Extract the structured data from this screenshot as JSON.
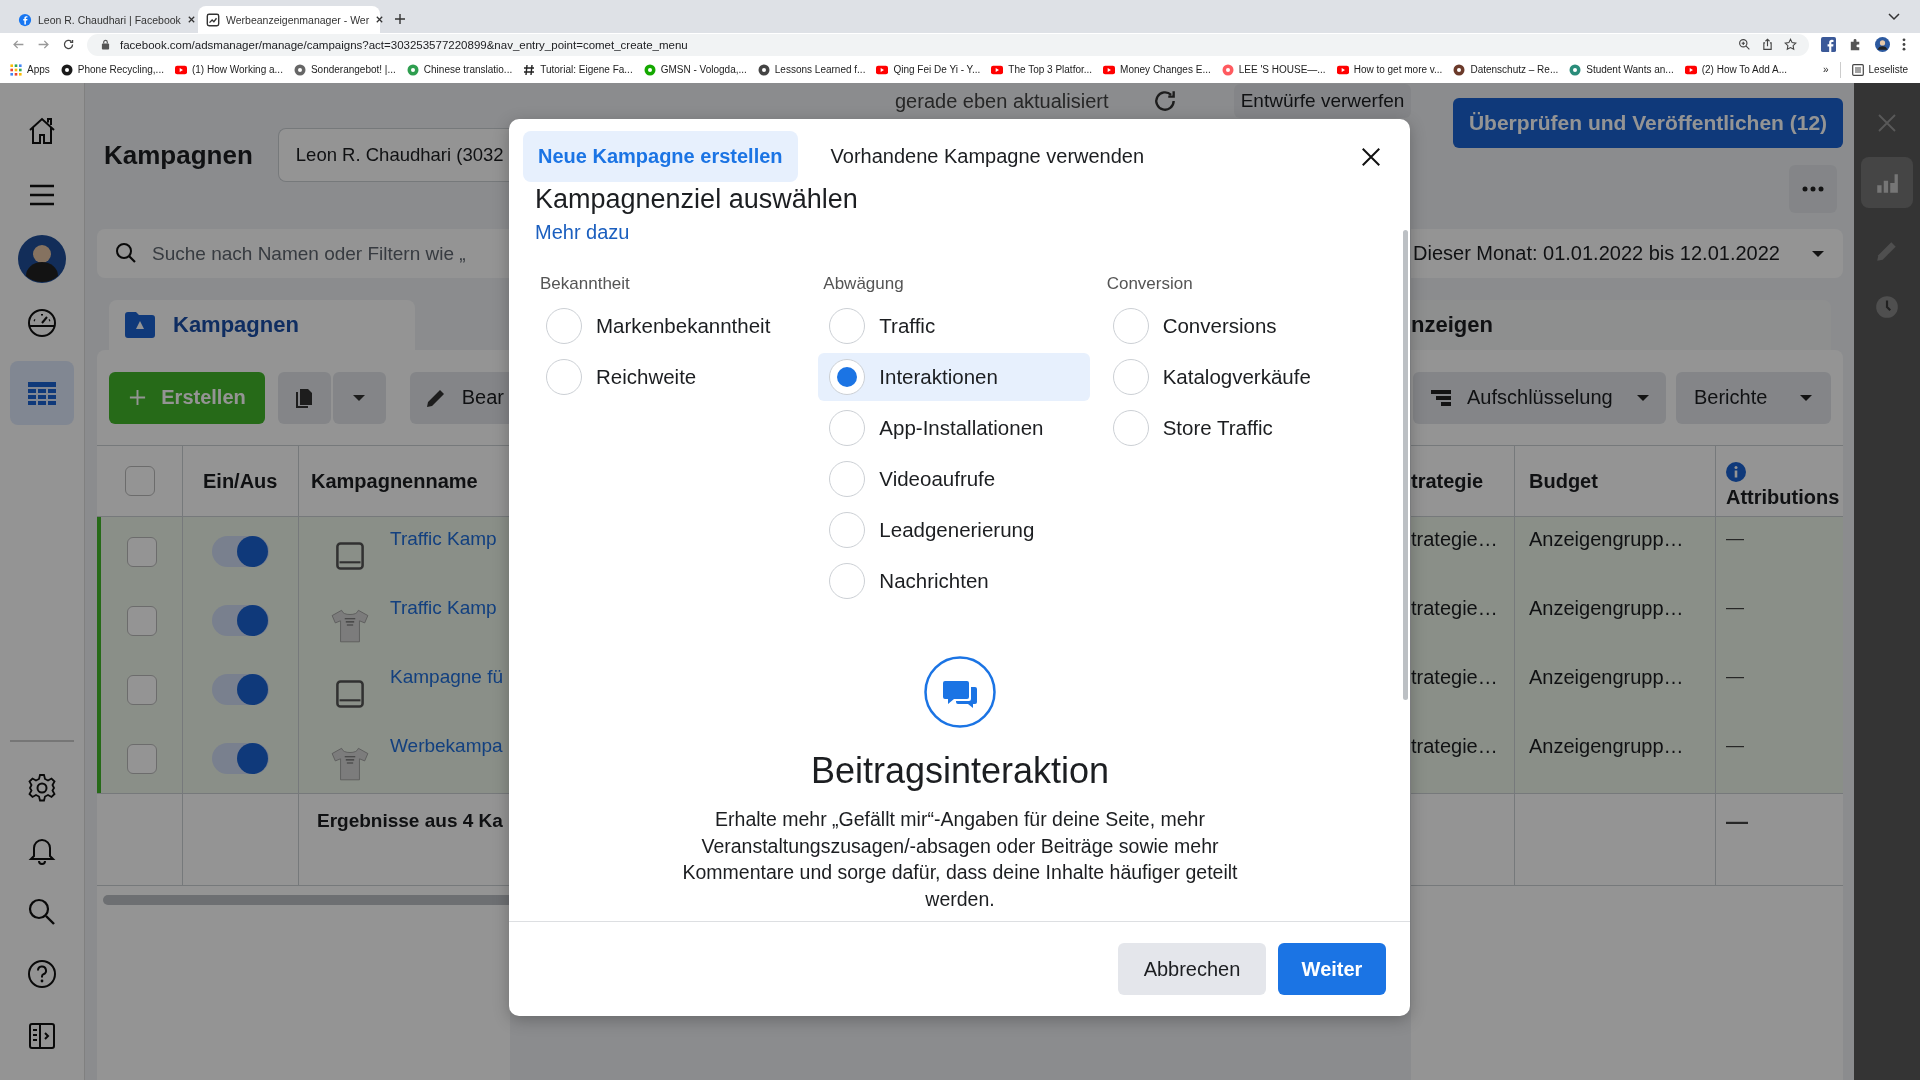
{
  "browser": {
    "tabs": [
      {
        "title": "Leon R. Chaudhari | Facebook",
        "selected": false,
        "kind": "facebook"
      },
      {
        "title": "Werbeanzeigenmanager - Wer",
        "selected": true,
        "kind": "ads"
      }
    ],
    "url": "facebook.com/adsmanager/manage/campaigns?act=303253577220899&nav_entry_point=comet_create_menu",
    "bookmarks": [
      {
        "label": "Apps",
        "kind": "apps"
      },
      {
        "label": "Phone Recycling,...",
        "kind": "o2"
      },
      {
        "label": "(1) How Working a...",
        "kind": "youtube"
      },
      {
        "label": "Sonderangebot! |...",
        "kind": "verified"
      },
      {
        "label": "Chinese translatio...",
        "kind": "leaf"
      },
      {
        "label": "Tutorial: Eigene Fa...",
        "kind": "hash"
      },
      {
        "label": "GMSN - Vologda,...",
        "kind": "up"
      },
      {
        "label": "Lessons Learned f...",
        "kind": "lessons"
      },
      {
        "label": "Qing Fei De Yi - Y...",
        "kind": "youtube"
      },
      {
        "label": "The Top 3 Platfor...",
        "kind": "youtube"
      },
      {
        "label": "Money Changes E...",
        "kind": "youtube"
      },
      {
        "label": "LEE 'S HOUSE—...",
        "kind": "airbnb"
      },
      {
        "label": "How to get more v...",
        "kind": "youtube"
      },
      {
        "label": "Datenschutz – Re...",
        "kind": "photo"
      },
      {
        "label": "Student Wants an...",
        "kind": "letter"
      },
      {
        "label": "(2) How To Add A...",
        "kind": "youtube"
      }
    ],
    "more": "»",
    "reading_list": "Leseliste"
  },
  "nav": {
    "top": [
      {
        "kind": "home",
        "selected": false
      },
      {
        "kind": "menu",
        "selected": false
      },
      {
        "kind": "profile",
        "selected": false
      },
      {
        "kind": "gauge",
        "selected": false
      },
      {
        "kind": "table",
        "selected": true
      }
    ],
    "bottom": [
      {
        "kind": "gear",
        "selected": false
      },
      {
        "kind": "bell",
        "selected": false
      },
      {
        "kind": "search",
        "selected": false
      },
      {
        "kind": "help",
        "selected": false
      },
      {
        "kind": "panel",
        "selected": false
      }
    ]
  },
  "header": {
    "title": "Kampagnen",
    "account": "Leon R. Chaudhari (3032",
    "status": "gerade eben aktualisiert",
    "discard": "Entwürfe verwerfen",
    "publish": "Überprüfen und Veröffentlichen (12)"
  },
  "search": {
    "placeholder": "Suche nach Namen oder Filtern wie „"
  },
  "date_range": "Dieser Monat: 01.01.2022 bis 12.01.2022",
  "level_tabs": [
    {
      "label": "Kampagnen",
      "selected": true
    },
    {
      "label": "nzeigen",
      "selected": false
    }
  ],
  "toolbar": {
    "create": "Erstellen",
    "edit": "Bear",
    "breakdown": "Aufschlüsselung",
    "reports": "Berichte"
  },
  "table": {
    "select_all_checked": false,
    "columns_left": [
      "Ein/Aus",
      "Kampagnenname"
    ],
    "columns_right": [
      "trategie",
      "Budget",
      "Attributions"
    ],
    "rows": [
      {
        "checked": false,
        "on": true,
        "kind": "device",
        "name": "Traffic Kamp",
        "strategy": "trategie…",
        "budget": "Anzeigengrupp…",
        "attribution": "—"
      },
      {
        "checked": false,
        "on": true,
        "kind": "shirt",
        "name": "Traffic Kamp",
        "strategy": "trategie…",
        "budget": "Anzeigengrupp…",
        "attribution": "—"
      },
      {
        "checked": false,
        "on": true,
        "kind": "device",
        "name": "Kampagne fü",
        "strategy": "trategie…",
        "budget": "Anzeigengrupp…",
        "attribution": "—"
      },
      {
        "checked": false,
        "on": true,
        "kind": "shirt",
        "name": "Werbekampa",
        "strategy": "trategie…",
        "budget": "Anzeigengrupp…",
        "attribution": "—"
      }
    ],
    "results": "Ergebnisse aus 4 Ka",
    "results_attribution": "—"
  },
  "modal": {
    "tabs": [
      {
        "label": "Neue Kampagne erstellen",
        "selected": true
      },
      {
        "label": "Vorhandene Kampagne verwenden",
        "selected": false
      }
    ],
    "heading": "Kampagnenziel auswählen",
    "link": "Mehr dazu",
    "groups": [
      {
        "title": "Bekanntheit",
        "options": [
          {
            "label": "Markenbekanntheit",
            "selected": false
          },
          {
            "label": "Reichweite",
            "selected": false
          }
        ]
      },
      {
        "title": "Abwägung",
        "options": [
          {
            "label": "Traffic",
            "selected": false
          },
          {
            "label": "Interaktionen",
            "selected": true
          },
          {
            "label": "App-Installationen",
            "selected": false
          },
          {
            "label": "Videoaufrufe",
            "selected": false
          },
          {
            "label": "Leadgenerierung",
            "selected": false
          },
          {
            "label": "Nachrichten",
            "selected": false
          }
        ]
      },
      {
        "title": "Conversion",
        "options": [
          {
            "label": "Conversions",
            "selected": false
          },
          {
            "label": "Katalogverkäufe",
            "selected": false
          },
          {
            "label": "Store Traffic",
            "selected": false
          }
        ]
      }
    ],
    "detail": {
      "title": "Beitragsinteraktion",
      "text": "Erhalte mehr „Gefällt mir“-Angaben für deine Seite, mehr Veranstaltungszusagen/-absagen oder Beiträge sowie mehr Kommentare und sorge dafür, dass deine Inhalte häufiger geteilt werden."
    },
    "cancel": "Abbrechen",
    "next": "Weiter"
  }
}
